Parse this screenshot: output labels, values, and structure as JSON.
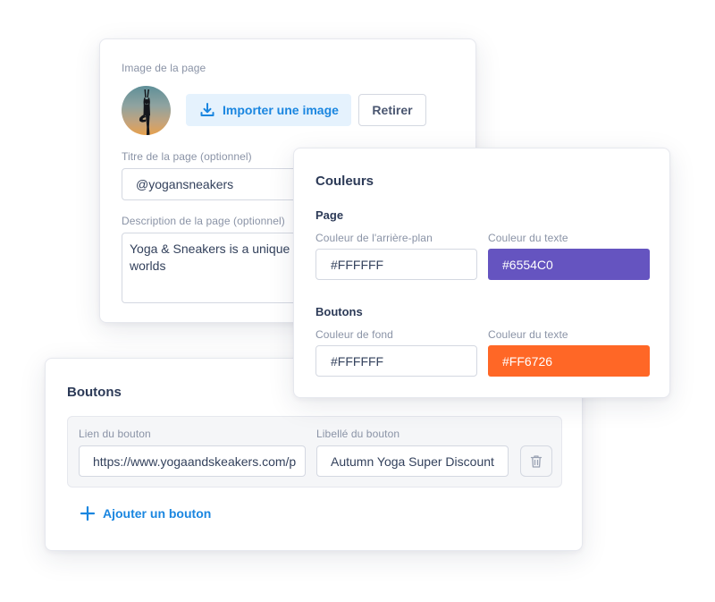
{
  "page_card": {
    "image_label": "Image de la page",
    "avatar_icon": "yoga-pose-avatar",
    "import_button": {
      "label": "Importer une image",
      "icon": "download-icon"
    },
    "remove_button": {
      "label": "Retirer"
    },
    "title_label": "Titre de la page (optionnel)",
    "title_value": "@yogansneakers",
    "description_label": "Description de la page (optionnel)",
    "description_value": "Yoga & Sneakers is a unique seamlessly blends the worlds"
  },
  "colors_card": {
    "title": "Couleurs",
    "page_section": {
      "title": "Page",
      "background_label": "Couleur de l'arrière-plan",
      "background_value": "#FFFFFF",
      "text_label": "Couleur du texte",
      "text_value": "#6554C0"
    },
    "buttons_section": {
      "title": "Boutons",
      "background_label": "Couleur de fond",
      "background_value": "#FFFFFF",
      "text_label": "Couleur du texte",
      "text_value": "#FF6726"
    }
  },
  "buttons_card": {
    "title": "Boutons",
    "rows": [
      {
        "link_label": "Lien du bouton",
        "link_value": "https://www.yogaandskeakers.com/p",
        "label_label": "Libellé du bouton",
        "label_value": "Autumn Yoga Super Discount",
        "delete_icon": "trash-icon"
      }
    ],
    "add_button": {
      "label": "Ajouter un bouton",
      "icon": "plus-icon"
    }
  },
  "colors": {
    "accent_blue": "#1A86E0",
    "purple": "#6554C0",
    "orange": "#FF6726"
  }
}
